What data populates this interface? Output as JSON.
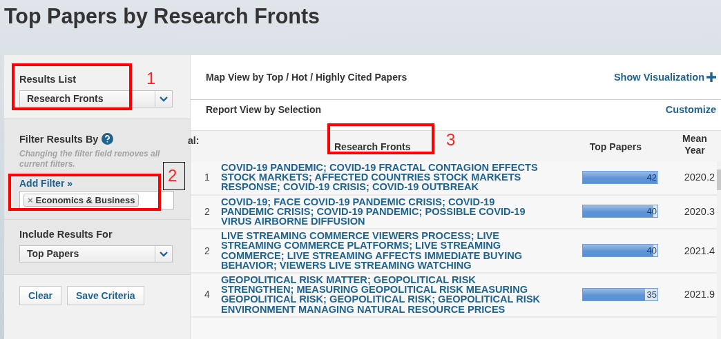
{
  "page_title": "Top Papers by Research Fronts",
  "sidebar": {
    "results_list": {
      "label": "Results List",
      "value": "Research Fronts"
    },
    "filter": {
      "label": "Filter Results By",
      "hint": "Changing the filter field removes all current filters.",
      "add_link": "Add Filter »",
      "chips": [
        {
          "remove": "×",
          "label": "Economics & Business"
        }
      ]
    },
    "include": {
      "label": "Include Results For",
      "value": "Top Papers"
    },
    "buttons": [
      "Clear",
      "Save Criteria"
    ]
  },
  "map_view": {
    "title": "Map View by Top / Hot / Highly Cited Papers",
    "link": "Show Visualization"
  },
  "report_view": {
    "title": "Report View by Selection",
    "link": "Customize"
  },
  "table": {
    "columns": [
      "al:",
      "Research Fronts",
      "Top Papers",
      "Mean Year"
    ],
    "rows": [
      {
        "rank": "1",
        "front": "COVID-19 PANDEMIC; COVID-19 FRACTAL CONTAGION EFFECTS STOCK MARKETS; AFFECTED COUNTRIES STOCK MARKETS RESPONSE; COVID-19 CRISIS; COVID-19 OUTBREAK",
        "level": 0.99,
        "papers": "42",
        "year": "2020.2"
      },
      {
        "rank": "2",
        "front": "COVID-19; FACE COVID-19 PANDEMIC CRISIS; COVID-19 PANDEMIC CRISIS; COVID-19 PANDEMIC; POSSIBLE COVID-19 VIRUS AIRBORNE DIFFUSION",
        "level": 0.94,
        "papers": "40",
        "year": "2020.3"
      },
      {
        "rank": "2",
        "front": "LIVE STREAMING COMMERCE VIEWERS PROCESS; LIVE STREAMING COMMERCE PLATFORMS; LIVE STREAMING COMMERCE; LIVE STREAMING AFFECTS IMMEDIATE BUYING BEHAVIOR; VIEWERS LIVE STREAMING WATCHING",
        "level": 0.94,
        "papers": "40",
        "year": "2021.4"
      },
      {
        "rank": "4",
        "front": "GEOPOLITICAL RISK MATTER; GEOPOLITICAL RISK STRENGTHEN; MEASURING GEOPOLITICAL RISK MEASURING GEOPOLITICAL RISK; GEOPOLITICAL RISK; GEOPOLITICAL RISK ENVIRONMENT MANAGING NATURAL RESOURCE PRICES",
        "level": 0.83,
        "papers": "35",
        "year": "2021.9"
      }
    ]
  },
  "annotations": [
    {
      "kind": "red",
      "number": "1"
    },
    {
      "kind": "red",
      "number": "2"
    },
    {
      "kind": "black"
    },
    {
      "kind": "red",
      "number": "3"
    }
  ]
}
